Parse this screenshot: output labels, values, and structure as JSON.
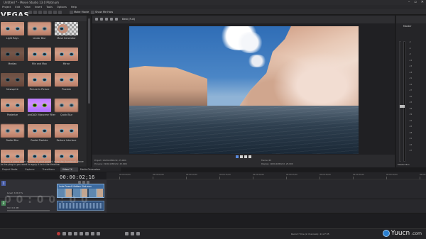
{
  "app": {
    "title": "Untitled * - Movie Studio 13.0 Platinum",
    "logo": "VEGAS",
    "win_controls": [
      "–",
      "▫",
      "✕"
    ]
  },
  "menu": [
    "Project",
    "Edit",
    "View",
    "Insert",
    "Tools",
    "Options",
    "Help"
  ],
  "toolbar": {
    "items": [
      {
        "label": "Make Movie",
        "icon": "film-icon"
      },
      {
        "label": "Show Me How",
        "icon": "help-icon"
      }
    ]
  },
  "fx_panel": {
    "effects": [
      {
        "label": "Light Rays",
        "style": ""
      },
      {
        "label": "Linear Blur",
        "style": ""
      },
      {
        "label": "Mask Generator",
        "style": "checker"
      },
      {
        "label": "Median",
        "style": ""
      },
      {
        "label": "Min and Max",
        "style": ""
      },
      {
        "label": "Mirror",
        "style": ""
      },
      {
        "label": "Newsprint",
        "style": ""
      },
      {
        "label": "Picture In Picture",
        "style": ""
      },
      {
        "label": "Pixelate",
        "style": ""
      },
      {
        "label": "Posterize",
        "style": ""
      },
      {
        "label": "proDAD Vitascene Filter",
        "style": "purple"
      },
      {
        "label": "Quick Blur",
        "style": ""
      },
      {
        "label": "Radial Blur",
        "style": ""
      },
      {
        "label": "Radial Pixelate",
        "style": ""
      },
      {
        "label": "Reduce Interlace",
        "style": ""
      },
      {
        "label": "",
        "style": ""
      },
      {
        "label": "",
        "style": ""
      },
      {
        "label": "",
        "style": ""
      }
    ],
    "description": "To apply a video effect or filter to your project, drag the thumbnail above to the plug-in you want to apply it to in the timeline."
  },
  "panel_tabs": [
    "Project Media",
    "Explorer",
    "Transitions",
    "Video FX",
    "Media Generators"
  ],
  "active_panel_tab": "Video FX",
  "preview": {
    "mode": "Best (Full)",
    "info": {
      "project": "Project:  1920x1080x32, 25.000i",
      "preview": "Preview:  1920x1080x32, 25.000i",
      "frame": "Frame:  65",
      "display": "Display:  1920x1080x32, 25.000"
    }
  },
  "mixer": {
    "label": "Master",
    "scale": [
      "-3",
      "-6",
      "-9",
      "-12",
      "-15",
      "-18",
      "-21",
      "-24",
      "-27",
      "-30",
      "-33",
      "-36",
      "-39",
      "-42",
      "-45",
      "-48",
      "-51",
      "-54",
      "-57"
    ],
    "footer": "Master Bus",
    "level_fraction": 0.47
  },
  "timeline": {
    "timecode": "00:00:02;16",
    "ruler": [
      "00:00:00;00",
      "00:00:05;00",
      "00:00:10;00",
      "00:00:15;00",
      "00:00:20;00",
      "00:00:25;00",
      "00:00:30;00",
      "00:00:35;00",
      "00:00:40;00",
      "00:00:45;00"
    ],
    "tracks": [
      {
        "num": "1",
        "level": "Level: 100.0 %"
      },
      {
        "num": "2",
        "level": "Vol: 0.0 dB"
      }
    ],
    "clip_name": "Lake Powell Hidden Slot.mov",
    "watermark": "0 0 : 0 0 : 0 0"
  },
  "transport": {
    "time_info": "Record Time (2 channels): 41:27:35"
  },
  "brand": {
    "name": "Yuucn",
    "suffix": ".com"
  }
}
